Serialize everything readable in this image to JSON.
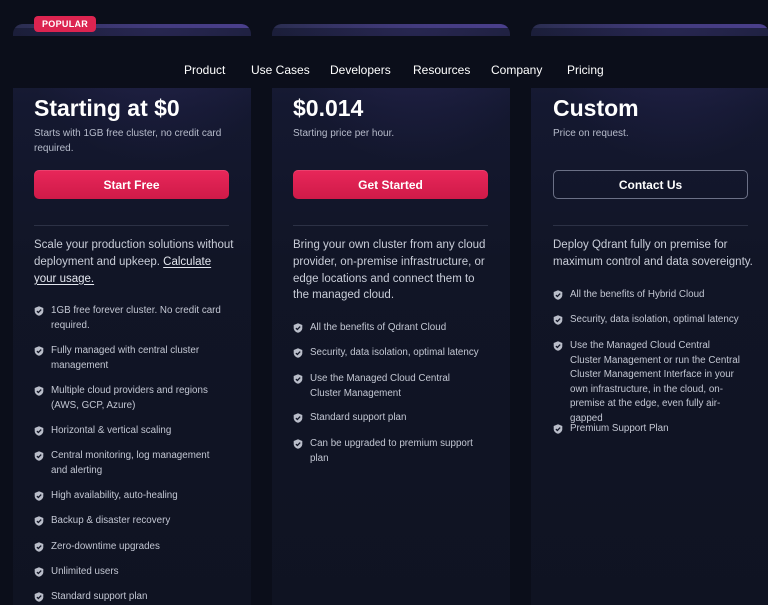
{
  "nav": {
    "items": [
      "Product",
      "Use Cases",
      "Developers",
      "Resources",
      "Company",
      "Pricing"
    ]
  },
  "badge": "POPULAR",
  "plans": [
    {
      "price": "Starting at $0",
      "subtitle": "Starts with 1GB free cluster, no credit card required.",
      "button": "Start Free",
      "button_style": "primary",
      "description": "Scale your production solutions without deployment and upkeep.",
      "description_link": "Calculate your usage.",
      "features": [
        "1GB free forever cluster. No credit card required.",
        "Fully managed with central cluster management",
        "Multiple cloud providers and regions (AWS, GCP, Azure)",
        "Horizontal & vertical scaling",
        "Central monitoring, log management and alerting",
        "High availability, auto-healing",
        "Backup & disaster recovery",
        "Zero-downtime upgrades",
        "Unlimited users",
        "Standard support plan"
      ]
    },
    {
      "price": "$0.014",
      "subtitle": "Starting price per hour.",
      "button": "Get Started",
      "button_style": "primary",
      "description": "Bring your own cluster from any cloud provider, on-premise infrastructure, or edge locations and connect them to the managed cloud.",
      "features": [
        "All the benefits of Qdrant Cloud",
        "Security, data isolation, optimal latency",
        "Use the Managed Cloud Central Cluster Management",
        "Standard support plan",
        "Can be upgraded to premium support plan"
      ]
    },
    {
      "price": "Custom",
      "subtitle": "Price on request.",
      "button": "Contact Us",
      "button_style": "outline",
      "description": "Deploy Qdrant fully on premise for maximum control and data sovereignty.",
      "features": [
        "All the benefits of Hybrid Cloud",
        "Security, data isolation, optimal latency",
        "Use the Managed Cloud Central Cluster Management or run the Central Cluster Management Interface in your own infrastructure, in the cloud, on-premise at the edge, even fully air-gapped",
        "Premium Support Plan"
      ]
    }
  ],
  "colors": {
    "background": "#0b0e1a",
    "accent": "#dc2450",
    "check": "#b9bdc9"
  },
  "icons": {
    "check": "check-shield-icon"
  }
}
